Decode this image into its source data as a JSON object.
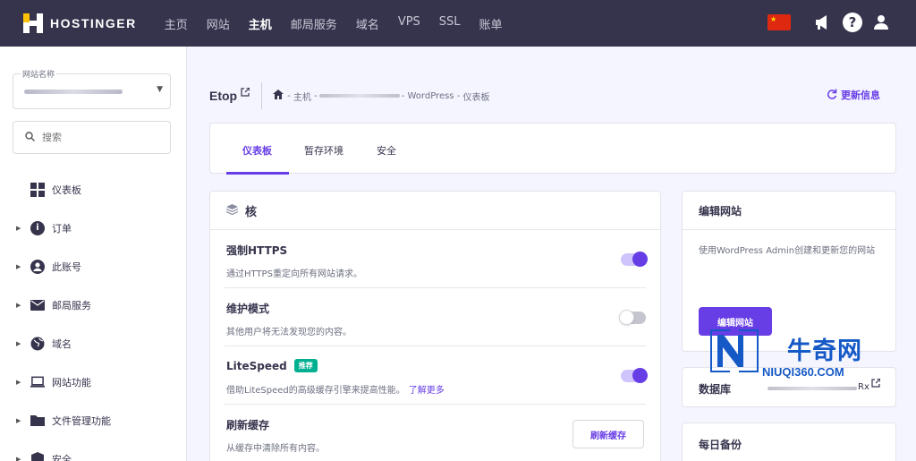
{
  "topbar": {
    "brand": "HOSTINGER",
    "nav": [
      "主页",
      "网站",
      "主机",
      "邮局服务",
      "域名",
      "VPS",
      "SSL",
      "账单"
    ],
    "active_nav": "主机",
    "help_glyph": "?"
  },
  "sidebar": {
    "site_select_label": "网站名称",
    "search_placeholder": "搜索",
    "items": [
      {
        "label": "仪表板",
        "icon": "dashboard-icon",
        "has_arrow": false
      },
      {
        "label": "订单",
        "icon": "info-icon",
        "has_arrow": true
      },
      {
        "label": "此账号",
        "icon": "account-icon",
        "has_arrow": true
      },
      {
        "label": "邮局服务",
        "icon": "mail-icon",
        "has_arrow": true
      },
      {
        "label": "域名",
        "icon": "globe-icon",
        "has_arrow": true
      },
      {
        "label": "网站功能",
        "icon": "laptop-icon",
        "has_arrow": true
      },
      {
        "label": "文件管理功能",
        "icon": "folder-icon",
        "has_arrow": true
      },
      {
        "label": "安全",
        "icon": "shield-icon",
        "has_arrow": true
      }
    ]
  },
  "header": {
    "title": "Etop",
    "breadcrumb": {
      "sep": "-",
      "host": "主机",
      "wp": "WordPress",
      "dash": "仪表板"
    },
    "refresh": "更新信息"
  },
  "tabs": [
    "仪表板",
    "暂存环境",
    "安全"
  ],
  "core": {
    "title": "核",
    "rows": [
      {
        "title": "强制HTTPS",
        "desc": "通过HTTPS重定向所有网站请求。",
        "toggle": "on"
      },
      {
        "title": "维护模式",
        "desc": "其他用户将无法发现您的内容。",
        "toggle": "off"
      },
      {
        "title": "LiteSpeed",
        "badge": "推荐",
        "desc": "借助LiteSpeed的高级缓存引擎来提高性能。",
        "link": "了解更多",
        "toggle": "on"
      },
      {
        "title": "刷新缓存",
        "desc": "从缓存中清除所有内容。",
        "button": "刷新缓存"
      }
    ]
  },
  "edit_site": {
    "title": "编辑网站",
    "desc": "使用WordPress Admin创建和更新您的网站",
    "button": "编辑网站"
  },
  "database": {
    "title": "数据库",
    "suffix": "Rx"
  },
  "backup": {
    "title": "每日备份"
  },
  "watermark": {
    "cn": "牛奇网",
    "en": "NIUQI360.COM"
  },
  "colors": {
    "accent": "#673de6",
    "topbar": "#36344d",
    "badge": "#00b090",
    "watermark": "#1559c6"
  }
}
